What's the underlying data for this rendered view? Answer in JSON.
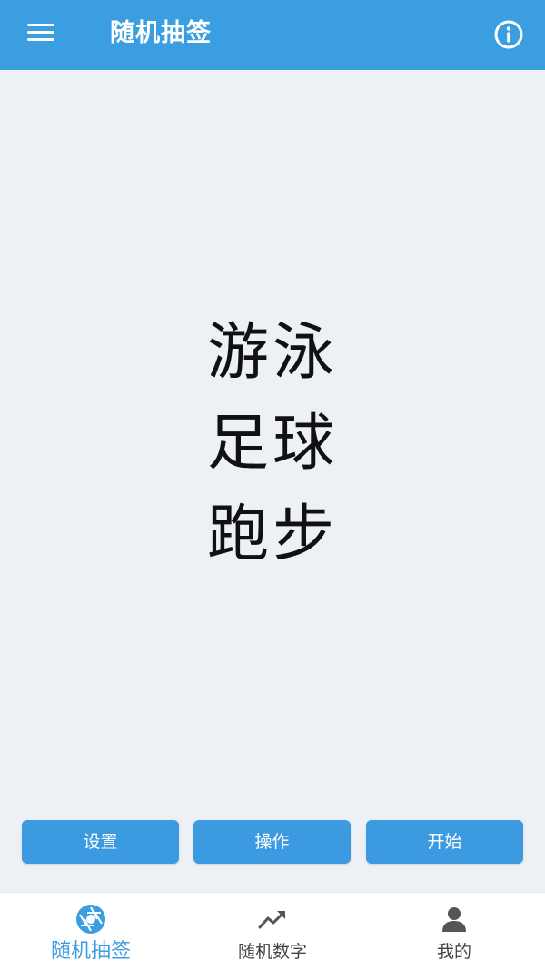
{
  "app_bar": {
    "title": "随机抽签",
    "menu_icon": "hamburger-menu-icon",
    "info_icon": "info-circle-icon"
  },
  "results": [
    "游泳",
    "足球",
    "跑步"
  ],
  "actions": {
    "settings_label": "设置",
    "operate_label": "操作",
    "start_label": "开始"
  },
  "bottom_nav": {
    "items": [
      {
        "label": "随机抽签",
        "icon": "aperture-icon",
        "active": true
      },
      {
        "label": "随机数字",
        "icon": "trending-up-icon",
        "active": false
      },
      {
        "label": "我的",
        "icon": "person-icon",
        "active": false
      }
    ]
  },
  "colors": {
    "primary": "#3a9ee0",
    "button": "#3c9ae0",
    "background": "#edf1f6",
    "inactive": "#555555"
  }
}
